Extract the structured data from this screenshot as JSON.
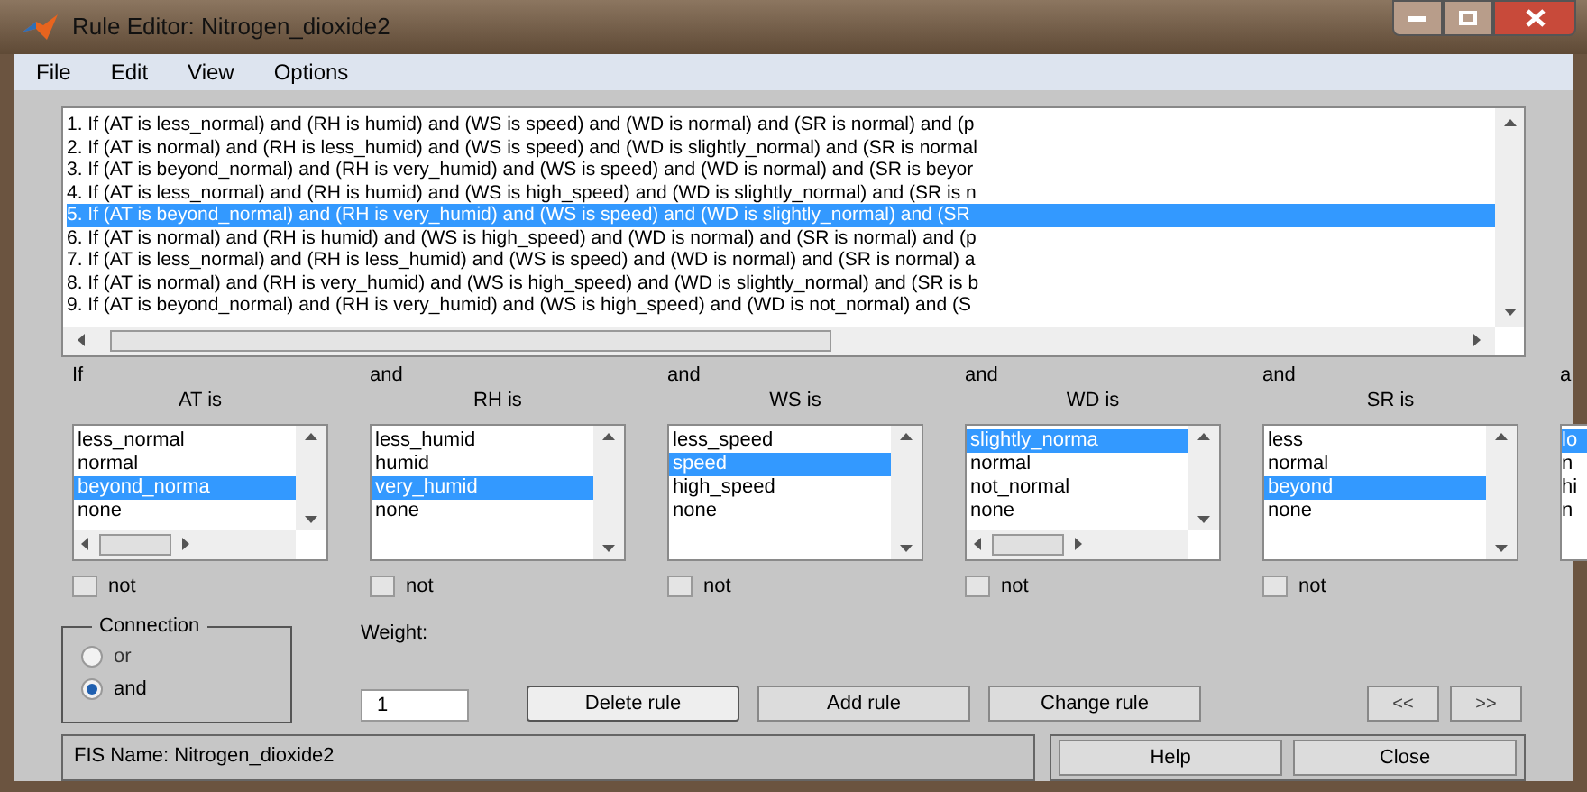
{
  "window": {
    "title": "Rule Editor: Nitrogen_dioxide2"
  },
  "menu": [
    "File",
    "Edit",
    "View",
    "Options"
  ],
  "rules": [
    {
      "text": "1. If (AT is less_normal) and (RH is humid) and (WS is speed) and (WD is normal) and (SR is normal) and (p",
      "selected": false
    },
    {
      "text": "2. If (AT is normal) and (RH is less_humid) and (WS is speed) and (WD is slightly_normal) and (SR is normal",
      "selected": false
    },
    {
      "text": "3. If (AT is beyond_normal) and (RH is very_humid) and (WS is speed) and (WD is normal) and (SR is beyor",
      "selected": false
    },
    {
      "text": "4. If (AT is less_normal) and (RH is humid) and (WS is high_speed) and (WD is slightly_normal) and (SR is n",
      "selected": false
    },
    {
      "text": "5. If (AT is beyond_normal) and (RH is very_humid) and (WS is speed) and (WD is slightly_normal) and (SR",
      "selected": true
    },
    {
      "text": "6. If (AT is normal) and (RH is humid) and (WS is high_speed) and (WD is normal) and (SR is normal) and (p",
      "selected": false
    },
    {
      "text": "7. If (AT is less_normal) and (RH is less_humid) and (WS is speed) and (WD is normal) and (SR is normal) a",
      "selected": false
    },
    {
      "text": "8. If (AT is normal) and (RH is very_humid) and (WS is high_speed) and (WD is slightly_normal) and (SR is b",
      "selected": false
    },
    {
      "text": "9. If (AT is beyond_normal) and (RH is very_humid) and (WS is high_speed) and (WD is not_normal) and (S",
      "selected": false
    }
  ],
  "inputs": [
    {
      "connector": "If",
      "name": "AT is",
      "hscroll": true,
      "not_label": "not",
      "not_checked": false,
      "items": [
        {
          "label": "less_normal",
          "selected": false
        },
        {
          "label": "normal",
          "selected": false
        },
        {
          "label": "beyond_norma",
          "selected": true
        },
        {
          "label": "none",
          "selected": false
        }
      ]
    },
    {
      "connector": "and",
      "name": "RH is",
      "hscroll": false,
      "not_label": "not",
      "not_checked": false,
      "items": [
        {
          "label": "less_humid",
          "selected": false
        },
        {
          "label": "humid",
          "selected": false
        },
        {
          "label": "very_humid",
          "selected": true
        },
        {
          "label": "none",
          "selected": false
        }
      ]
    },
    {
      "connector": "and",
      "name": "WS is",
      "hscroll": false,
      "not_label": "not",
      "not_checked": false,
      "items": [
        {
          "label": "less_speed",
          "selected": false
        },
        {
          "label": "speed",
          "selected": true
        },
        {
          "label": "high_speed",
          "selected": false
        },
        {
          "label": "none",
          "selected": false
        }
      ]
    },
    {
      "connector": "and",
      "name": "WD is",
      "hscroll": true,
      "not_label": "not",
      "not_checked": false,
      "items": [
        {
          "label": "slightly_norma",
          "selected": true
        },
        {
          "label": "normal",
          "selected": false
        },
        {
          "label": "not_normal",
          "selected": false
        },
        {
          "label": "none",
          "selected": false
        }
      ]
    },
    {
      "connector": "and",
      "name": "SR is",
      "hscroll": false,
      "not_label": "not",
      "not_checked": false,
      "items": [
        {
          "label": "less",
          "selected": false
        },
        {
          "label": "normal",
          "selected": false
        },
        {
          "label": "beyond",
          "selected": true
        },
        {
          "label": "none",
          "selected": false
        }
      ]
    }
  ],
  "cut_input": {
    "connector": "a",
    "items": [
      {
        "label": "lo",
        "selected": true
      },
      {
        "label": "n",
        "selected": false
      },
      {
        "label": "hi",
        "selected": false
      },
      {
        "label": "n",
        "selected": false
      }
    ]
  },
  "connection": {
    "title": "Connection",
    "options": [
      {
        "label": "or",
        "selected": false
      },
      {
        "label": "and",
        "selected": true
      }
    ]
  },
  "weight": {
    "label": "Weight:",
    "value": "1"
  },
  "buttons": [
    {
      "label": "Delete rule",
      "kind": "focused"
    },
    {
      "label": "Add rule",
      "kind": "normal"
    },
    {
      "label": "Change rule",
      "kind": "normal"
    }
  ],
  "nav": [
    "<<",
    ">>"
  ],
  "status": "FIS Name: Nitrogen_dioxide2",
  "footer_buttons": [
    "Help",
    "Close"
  ]
}
